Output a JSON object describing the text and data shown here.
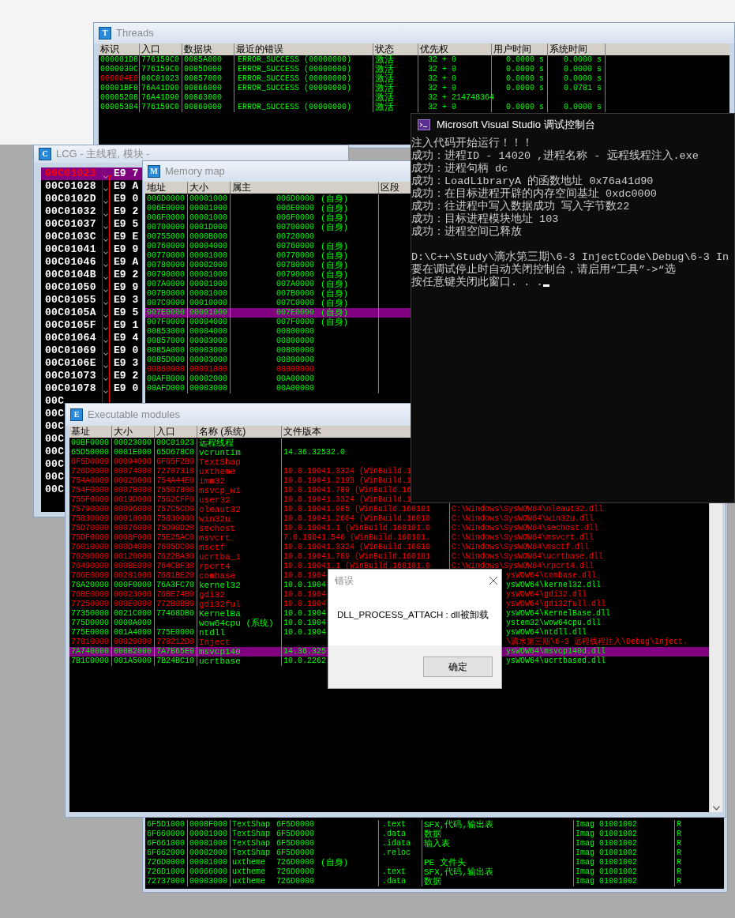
{
  "threads": {
    "icon_letter": "T",
    "title": "Threads",
    "columns": [
      "标识",
      "入口",
      "数据块",
      "最近的错误",
      "状态",
      "优先权",
      "用户时间",
      "系统时间"
    ],
    "rows": [
      {
        "id": "000001D8",
        "entry": "776159C0",
        "data_block": "0085A000",
        "last_error": "ERROR_SUCCESS (00000000)",
        "state": "激活",
        "priority": "32 + 0",
        "user_time": "0.0000 s",
        "system_time": "0.0000 s",
        "current": false
      },
      {
        "id": "0000030C",
        "entry": "776159C0",
        "data_block": "0085D000",
        "last_error": "ERROR_SUCCESS (00000000)",
        "state": "激活",
        "priority": "32 + 0",
        "user_time": "0.0000 s",
        "system_time": "0.0000 s",
        "current": false
      },
      {
        "id": "000004E0",
        "entry": "00C01023",
        "data_block": "00857000",
        "last_error": "ERROR_SUCCESS (00000000)",
        "state": "激活",
        "priority": "32 + 0",
        "user_time": "0.0000 s",
        "system_time": "0.0000 s",
        "current": true
      },
      {
        "id": "00001BF8",
        "entry": "76A41D90",
        "data_block": "00866000",
        "last_error": "ERROR_SUCCESS (00000000)",
        "state": "激活",
        "priority": "32 + 0",
        "user_time": "0.0000 s",
        "system_time": "0.0781 s",
        "current": false
      },
      {
        "id": "00005208",
        "entry": "76A41D90",
        "data_block": "00863000",
        "state": "激活",
        "priority": "32 + 214748364",
        "current": false
      },
      {
        "id": "00005384",
        "entry": "776159C0",
        "data_block": "00860000",
        "last_error": "ERROR_SUCCESS (00000000)",
        "state": "激活",
        "priority": "32 + 0",
        "user_time": "0.0000 s",
        "system_time": "0.0000 s",
        "current": false
      }
    ]
  },
  "cpu": {
    "icon_letter": "C",
    "title": "LCG - 主线程, 模块 -",
    "rows": [
      {
        "address": "00C01023",
        "code": "E9 7",
        "selected": true
      },
      {
        "address": "00C01028",
        "code": "E9 A",
        "selected": false
      },
      {
        "address": "00C0102D",
        "code": "E9 0",
        "selected": false
      },
      {
        "address": "00C01032",
        "code": "E9 2",
        "selected": false
      },
      {
        "address": "00C01037",
        "code": "E9 5",
        "selected": false
      },
      {
        "address": "00C0103C",
        "code": "E9 E",
        "selected": false
      },
      {
        "address": "00C01041",
        "code": "E9 9",
        "selected": false
      },
      {
        "address": "00C01046",
        "code": "E9 A",
        "selected": false
      },
      {
        "address": "00C0104B",
        "code": "E9 2",
        "selected": false
      },
      {
        "address": "00C01050",
        "code": "E9 9",
        "selected": false
      },
      {
        "address": "00C01055",
        "code": "E9 3",
        "selected": false
      },
      {
        "address": "00C0105A",
        "code": "E9 5",
        "selected": false
      },
      {
        "address": "00C0105F",
        "code": "E9 1",
        "selected": false
      },
      {
        "address": "00C01064",
        "code": "E9 4",
        "selected": false
      },
      {
        "address": "00C01069",
        "code": "E9 0",
        "selected": false
      },
      {
        "address": "00C0106E",
        "code": "E9 3",
        "selected": false
      },
      {
        "address": "00C01073",
        "code": "E9 2",
        "selected": false
      },
      {
        "address": "00C01078",
        "code": "E9 0",
        "selected": false
      },
      {
        "address": "00C",
        "selected": false
      },
      {
        "address": "00C",
        "selected": false
      },
      {
        "address": "00C",
        "selected": false
      },
      {
        "address": "00C",
        "selected": false
      },
      {
        "address": "00C",
        "selected": false
      },
      {
        "address": "00C",
        "selected": false
      },
      {
        "address": "00C",
        "selected": false
      },
      {
        "address": "00C",
        "selected": false
      }
    ]
  },
  "memory_map": {
    "icon_letter": "M",
    "title": "Memory map",
    "columns": [
      "地址",
      "大小",
      "属主",
      "区段"
    ],
    "rows": [
      {
        "address": "006D0000",
        "size": "00001000",
        "owner": "006D0000",
        "tag": "(自身)",
        "changed": false,
        "selected": false
      },
      {
        "address": "006E0000",
        "size": "00001000",
        "owner": "006E0000",
        "tag": "(自身)",
        "changed": false,
        "selected": false
      },
      {
        "address": "006F0000",
        "size": "00001000",
        "owner": "006F0000",
        "tag": "(自身)",
        "changed": false,
        "selected": false
      },
      {
        "address": "00700000",
        "size": "0001D000",
        "owner": "00700000",
        "tag": "(自身)",
        "changed": false,
        "selected": false
      },
      {
        "address": "00755000",
        "size": "0000B000",
        "owner": "00720000",
        "changed": false,
        "selected": false
      },
      {
        "address": "00760000",
        "size": "00004000",
        "owner": "00760000",
        "tag": "(自身)",
        "changed": false,
        "selected": false
      },
      {
        "address": "00770000",
        "size": "00001000",
        "owner": "00770000",
        "tag": "(自身)",
        "changed": false,
        "selected": false
      },
      {
        "address": "00780000",
        "size": "00002000",
        "owner": "00780000",
        "tag": "(自身)",
        "changed": false,
        "selected": false
      },
      {
        "address": "00790000",
        "size": "00001000",
        "owner": "00790000",
        "tag": "(自身)",
        "changed": false,
        "selected": false
      },
      {
        "address": "007A0000",
        "size": "00001000",
        "owner": "007A0000",
        "tag": "(自身)",
        "changed": false,
        "selected": false
      },
      {
        "address": "007B0000",
        "size": "00001000",
        "owner": "007B0000",
        "tag": "(自身)",
        "changed": false,
        "selected": false
      },
      {
        "address": "007C0000",
        "size": "00010000",
        "owner": "007C0000",
        "tag": "(自身)",
        "changed": false,
        "selected": false
      },
      {
        "address": "007E0000",
        "size": "00001000",
        "owner": "007E0000",
        "tag": "(自身)",
        "changed": false,
        "selected": true
      },
      {
        "address": "007F0000",
        "size": "00004000",
        "owner": "007F0000",
        "tag": "(自身)",
        "changed": false,
        "selected": false
      },
      {
        "address": "00853000",
        "size": "00004000",
        "owner": "00800000",
        "changed": false,
        "selected": false
      },
      {
        "address": "00857000",
        "size": "00003000",
        "owner": "00800000",
        "changed": false,
        "selected": false
      },
      {
        "address": "0085A000",
        "size": "00003000",
        "owner": "00800000",
        "changed": false,
        "selected": false
      },
      {
        "address": "0085D000",
        "size": "00003000",
        "owner": "00800000",
        "changed": false,
        "selected": false
      },
      {
        "address": "00860000",
        "size": "00001000",
        "owner": "00800000",
        "changed": true,
        "selected": false
      },
      {
        "address": "00AFB000",
        "size": "00002000",
        "owner": "00A00000",
        "changed": false,
        "selected": false
      },
      {
        "address": "00AFD000",
        "size": "00003000",
        "owner": "00A00000",
        "changed": false,
        "selected": false
      }
    ],
    "lower_rows": [
      {
        "address": "6F5D1000",
        "size": "0008F000",
        "owner_name": "TextShap",
        "owner": "6F5D0000",
        "section": ".text",
        "contains": "SFX,代码,输出表",
        "type": "Imag 01001002",
        "access": "R"
      },
      {
        "address": "6F660000",
        "size": "00001000",
        "owner_name": "TextShap",
        "owner": "6F5D0000",
        "section": ".data",
        "contains": "数据",
        "type": "Imag 01001002",
        "access": "R"
      },
      {
        "address": "6F661000",
        "size": "00001000",
        "owner_name": "TextShap",
        "owner": "6F5D0000",
        "section": ".idata",
        "contains": "输入表",
        "type": "Imag 01001002",
        "access": "R"
      },
      {
        "address": "6F662000",
        "size": "00002000",
        "owner_name": "TextShap",
        "owner": "6F5D0000",
        "section": ".reloc",
        "type": "Imag 01001002",
        "access": "R"
      },
      {
        "address": "726D0000",
        "size": "00001000",
        "owner_name": "uxtheme",
        "owner": "726D0000",
        "tag": "(自身)",
        "contains": "PE 文件头",
        "type": "Imag 01001002",
        "access": "R"
      },
      {
        "address": "726D1000",
        "size": "00066000",
        "owner_name": "uxtheme",
        "owner": "726D0000",
        "section": ".text",
        "contains": "SFX,代码,输出表",
        "type": "Imag 01001002",
        "access": "R"
      },
      {
        "address": "72737000",
        "size": "00003000",
        "owner_name": "uxtheme",
        "owner": "726D0000",
        "section": ".data",
        "contains": "数据",
        "type": "Imag 01001002",
        "access": "R"
      }
    ]
  },
  "modules": {
    "icon_letter": "E",
    "title": "Executable modules",
    "columns": [
      "基址",
      "大小",
      "入口",
      "名称 (系统)",
      "文件版本"
    ],
    "rows": [
      {
        "kind": "full",
        "base": "00BF0000",
        "size": "00023000",
        "entry": "00C01023",
        "name": "远程线程",
        "highlighted": false,
        "selected": false
      },
      {
        "kind": "full",
        "base": "65D50000",
        "size": "0001E000",
        "entry": "65D678C0",
        "name": "vcruntim",
        "version": "14.36.32532.0",
        "highlighted": false,
        "selected": false
      },
      {
        "kind": "full",
        "base": "6F5D0000",
        "size": "00094000",
        "entry": "6F65F2B0",
        "name": "TextShap",
        "highlighted": true,
        "selected": false
      },
      {
        "kind": "full",
        "base": "726D0000",
        "size": "00074000",
        "entry": "72707310",
        "name": "uxtheme",
        "version": "10.0.19041.3324 (WinBuild.1",
        "highlighted": true,
        "selected": false
      },
      {
        "kind": "full",
        "base": "754A0000",
        "size": "00026000",
        "entry": "754A44E0",
        "name": "imm32",
        "version": "10.0.19041.2193 (WinBuild.1",
        "highlighted": true,
        "selected": false
      },
      {
        "kind": "full",
        "base": "754F0000",
        "size": "0007B000",
        "entry": "75507800",
        "name": "msvcp_wi",
        "version": "10.0.19041.789 (WinBuild.16",
        "highlighted": true,
        "selected": false
      },
      {
        "kind": "full",
        "base": "755F0000",
        "size": "0019D000",
        "entry": "7562CFF0",
        "name": "user32",
        "version": "10.0.19041.3324 (WinBuild.1",
        "highlighted": true,
        "selected": false
      },
      {
        "kind": "full",
        "base": "75790000",
        "size": "00096000",
        "entry": "757C5CD0",
        "name": "oleaut32",
        "version": "10.0.19041.985 (WinBuild.160101",
        "path": "C:\\Windows\\SysWOW64\\oleaut32.dll",
        "highlighted": true,
        "selected": false
      },
      {
        "kind": "full",
        "base": "75830000",
        "size": "00018000",
        "entry": "75830000",
        "name": "win32u",
        "version": "10.0.19041.2604 (WinBuild.16010",
        "path": "C:\\Windows\\SysWOW64\\win32u.dll",
        "highlighted": true,
        "selected": false
      },
      {
        "kind": "full",
        "base": "75D70000",
        "size": "00076000",
        "entry": "75D90D20",
        "name": "sechost",
        "version": "10.0.19041.1 (WinBuild.160101.0",
        "path": "C:\\Windows\\SysWOW64\\sechost.dll",
        "highlighted": true,
        "selected": false
      },
      {
        "kind": "full",
        "base": "75DF0000",
        "size": "000BF000",
        "entry": "75E25AC0",
        "name": "msvcrt",
        "version": "7.0.19041.546 (WinBuild.160101.",
        "path": "C:\\Windows\\SysWOW64\\msvcrt.dll",
        "highlighted": true,
        "selected": false
      },
      {
        "kind": "full",
        "base": "76010000",
        "size": "000D4000",
        "entry": "7605DC00",
        "name": "msctf",
        "version": "10.0.19041.3324 (WinBuild.16010",
        "path": "C:\\Windows\\SysWOW64\\msctf.dll",
        "highlighted": true,
        "selected": false
      },
      {
        "kind": "full",
        "base": "76200000",
        "size": "00120000",
        "entry": "7622BA30",
        "name": "ucrtba_1",
        "version": "10.0.19041.789 (WinBuild.160101",
        "path": "C:\\Windows\\SysWOW64\\ucrtbase.dll",
        "highlighted": true,
        "selected": false
      },
      {
        "kind": "full",
        "base": "76490000",
        "size": "000BE000",
        "entry": "764CBF30",
        "name": "rpcrt4",
        "version": "10.0.19041.1 (WinBuild.160101.0",
        "path": "C:\\Windows\\SysWOW64\\rpcrt4.dll",
        "highlighted": true,
        "selected": false
      },
      {
        "kind": "clipped",
        "base": "766E0000",
        "size": "00281000",
        "entry": "7681BE20",
        "name": "combase",
        "version": "10.0.1904",
        "path": "ysWOW64\\combase.dll",
        "highlighted": true,
        "selected": false
      },
      {
        "kind": "clipped",
        "base": "76A20000",
        "size": "000F0000",
        "entry": "76A3FC70",
        "name": "kernel32",
        "version": "10.0.1904",
        "path": "ysWOW64\\kernel32.dll",
        "highlighted": false,
        "selected": false
      },
      {
        "kind": "clipped",
        "base": "76BE0000",
        "size": "00023000",
        "entry": "76BE74B0",
        "name": "gdi32",
        "version": "10.0.1904",
        "path": "ysWOW64\\gdi32.dll",
        "highlighted": true,
        "selected": false
      },
      {
        "kind": "clipped",
        "base": "77250000",
        "size": "000E0000",
        "entry": "772B0BB0",
        "name": "gdi32ful",
        "version": "10.0.1904",
        "path": "ysWOW64\\gdi32full.dll",
        "highlighted": true,
        "selected": false
      },
      {
        "kind": "clipped",
        "base": "77350000",
        "size": "0021C000",
        "entry": "77468DB0",
        "name": "KernelBa",
        "version": "10.0.1904",
        "path": "ysWOW64\\KernelBase.dll",
        "highlighted": false,
        "selected": false
      },
      {
        "kind": "clipped",
        "base": "775D0000",
        "size": "0000A000",
        "name": "wow64cpu (系统)",
        "version": "10.0.1904",
        "path": "ystem32\\wow64cpu.dll",
        "highlighted": false,
        "selected": false
      },
      {
        "kind": "clipped",
        "base": "775E0000",
        "size": "001A4000",
        "entry": "775E0000",
        "name": "ntdll",
        "version": "10.0.1904",
        "path": "ysWOW64\\ntdll.dll",
        "highlighted": false,
        "selected": false
      },
      {
        "kind": "clipped",
        "base": "77810000",
        "size": "00020000",
        "entry": "778212D0",
        "name": "Inject",
        "path": "\\滴水第三期\\6-3 远程线程注入\\Debug\\Inject.",
        "highlighted": true,
        "selected": false
      },
      {
        "kind": "clipped",
        "base": "7A740000",
        "size": "000B2000",
        "entry": "7A7B65E0",
        "name": "msvcp140",
        "version": "14.36.325",
        "path": "ysWOW64\\msvcp140d.dll",
        "highlighted": false,
        "selected": true
      },
      {
        "kind": "clipped",
        "base": "7B1C0000",
        "size": "001A5000",
        "entry": "7B24BC10",
        "name": "ucrtbase",
        "version": "10.0.2262",
        "path": "ysWOW64\\ucrtbased.dll",
        "highlighted": false,
        "selected": false
      }
    ]
  },
  "console": {
    "title": "Microsoft Visual Studio 调试控制台",
    "blocks": [
      [
        "注入代码开始运行！！！",
        "成功：进程ID - 14020 ,进程名称 - 远程线程注入.exe",
        "成功：进程句柄 dc",
        "成功：LoadLibraryA 的函数地址 0x76a41d90",
        "成功：在目标进程开辟的内存空间基址 0xdc0000",
        "成功：往进程中写入数据成功 写入字节数22",
        "成功：目标进程模块地址 103",
        "成功：进程空间已释放"
      ],
      [
        "D:\\C++\\Study\\滴水第三期\\6-3 InjectCode\\Debug\\6-3 In",
        "要在调试停止时自动关闭控制台，请启用“工具”->“选",
        "按任意键关闭此窗口. . ."
      ]
    ]
  },
  "dialog": {
    "title": "错误",
    "message": "DLL_PROCESS_ATTACH : dll被卸载",
    "button": "确定"
  }
}
